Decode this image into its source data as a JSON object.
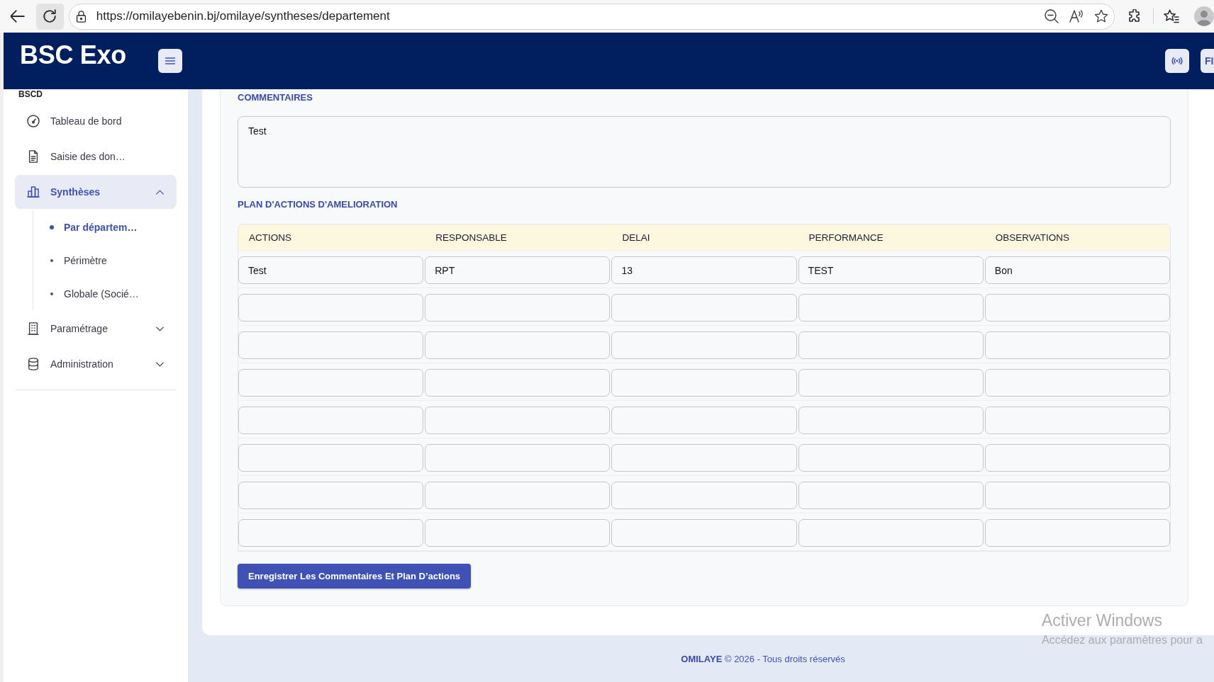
{
  "browser": {
    "url": "https://omilayebenin.bj/omilaye/syntheses/departement"
  },
  "app_bar": {
    "title": "BSC Exo",
    "user_button": "FI"
  },
  "sidebar": {
    "section_label": "BSCD",
    "items": [
      {
        "kind": "link",
        "label": "Tableau de bord",
        "selected": false
      },
      {
        "kind": "link",
        "label": "Saisie des don…",
        "selected": false
      },
      {
        "kind": "group",
        "label": "Synthèses",
        "selected": true,
        "expanded": true,
        "children": [
          {
            "label": "Par départem…",
            "selected": true
          },
          {
            "label": "Périmètre",
            "selected": false
          },
          {
            "label": "Globale (Socié…",
            "selected": false
          }
        ]
      },
      {
        "kind": "group",
        "label": "Paramétrage",
        "selected": false,
        "expanded": false
      },
      {
        "kind": "group",
        "label": "Administration",
        "selected": false,
        "expanded": false
      }
    ]
  },
  "comments": {
    "title": "COMMENTAIRES",
    "value": "Test"
  },
  "action_plan": {
    "title": "PLAN D'ACTIONS D'AMELIORATION",
    "columns": [
      "ACTIONS",
      "RESPONSABLE",
      "DELAI",
      "PERFORMANCE",
      "OBSERVATIONS"
    ],
    "rows": [
      {
        "cells": [
          "Test",
          "RPT",
          "13",
          "TEST",
          "Bon"
        ]
      },
      {},
      {},
      {},
      {},
      {},
      {},
      {}
    ]
  },
  "save_button": "Enregistrer Les Commentaires Et Plan D’actions",
  "footer": "**OMILAYE** © 2026 - Tous droits réservés",
  "os_notice": {
    "title": "Activer Windows",
    "text": "Accédez aux paramètres pour a"
  }
}
